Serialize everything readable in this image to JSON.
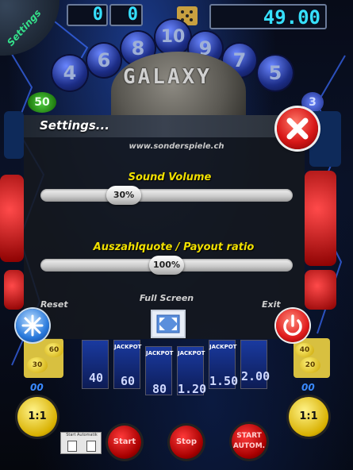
{
  "top_bar": {
    "settings_tab": "Settings",
    "display_left": "0",
    "display_mid": "0",
    "display_right": "49.00"
  },
  "balls": [
    "4",
    "6",
    "8",
    "10",
    "9",
    "7",
    "5"
  ],
  "galaxy_title": "GALAXY",
  "side_badges": {
    "left_top": "50",
    "right_top": "3"
  },
  "dialog": {
    "title": "Settings...",
    "url": "www.sonderspiele.ch",
    "sound": {
      "label": "Sound Volume",
      "value_text": "30%",
      "value": 0.3
    },
    "payout": {
      "label": "Auszahlquote / Payout ratio",
      "value_text": "100%",
      "value": 1.0
    },
    "reset_label": "Reset",
    "fullscreen_label": "Full Screen",
    "exit_label": "Exit"
  },
  "left_coins": [
    "60",
    "30"
  ],
  "right_coins": [
    "40",
    "20"
  ],
  "reels": [
    {
      "jackpot": "",
      "value": "40"
    },
    {
      "jackpot": "JACKPOT",
      "value": "60"
    },
    {
      "jackpot": "JACKPOT",
      "value": "80"
    },
    {
      "jackpot": "JACKPOT",
      "value": "1.20"
    },
    {
      "jackpot": "JACKPOT",
      "value": "1.50"
    },
    {
      "jackpot": "",
      "value": "2.00"
    }
  ],
  "left_oo": "00",
  "right_oo": "00",
  "nofu_label": "1:1",
  "bottom_buttons": [
    "Start",
    "Stop",
    "START AUTOM."
  ],
  "small_panel_label": "Start Automatik",
  "colors": {
    "accent_yellow": "#f0e000",
    "close_red": "#d81818",
    "display_cyan": "#36e0ff"
  }
}
